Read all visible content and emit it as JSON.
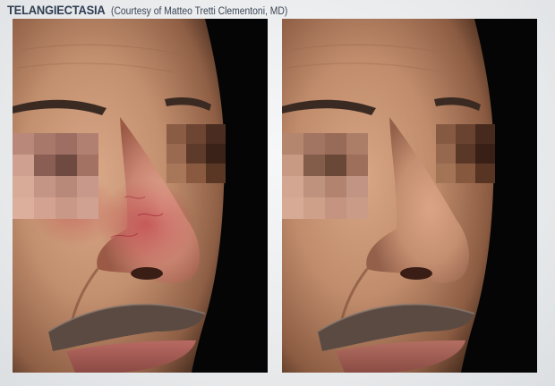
{
  "caption": {
    "title": "TELANGIECTASIA",
    "credit": "(Courtesy of Matteo Tretti Clementoni, MD)"
  },
  "photos": [
    {
      "state": "before",
      "redness_visible": true,
      "eyes_pixelated": true
    },
    {
      "state": "after",
      "redness_visible": false,
      "eyes_pixelated": true
    }
  ],
  "colors": {
    "caption_text": "#2e3c50",
    "background": "#eceef0",
    "photo_background": "#050505",
    "skin": "#c49070",
    "redness": "#c0404a"
  }
}
